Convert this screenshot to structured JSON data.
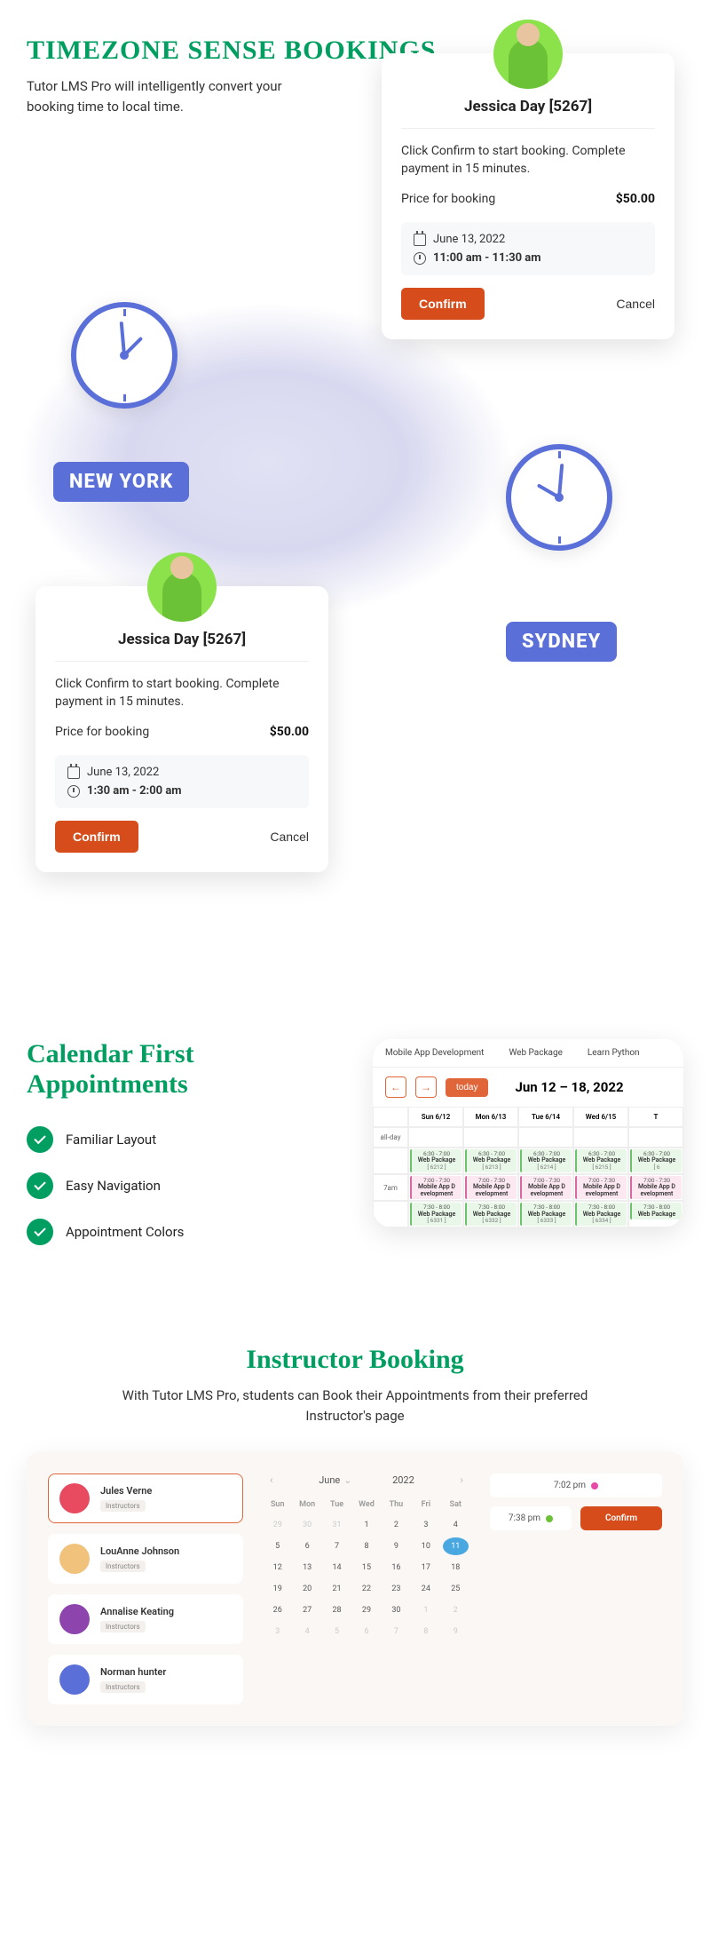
{
  "section1": {
    "heading": "Timezone Sense Bookings",
    "sub": "Tutor LMS Pro will intelligently convert your booking time to local time.",
    "city_ny": "NEW YORK",
    "city_sydney": "SYDNEY"
  },
  "card1": {
    "name": "Jessica Day [5267]",
    "desc": "Click Confirm to start booking. Complete payment in 15 minutes.",
    "price_label": "Price for booking",
    "price": "$50.00",
    "date": "June 13, 2022",
    "time": "11:00 am  -  11:30 am",
    "confirm": "Confirm",
    "cancel": "Cancel"
  },
  "card2": {
    "name": "Jessica Day [5267]",
    "desc": "Click Confirm to start booking. Complete payment in 15 minutes.",
    "price_label": "Price for booking",
    "price": "$50.00",
    "date": "June 13, 2022",
    "time": "1:30 am  -  2:00 am",
    "confirm": "Confirm",
    "cancel": "Cancel"
  },
  "section2": {
    "heading": "Calendar First Appointments",
    "check1": "Familiar Layout",
    "check2": "Easy Navigation",
    "check3": "Appointment Colors"
  },
  "calprev": {
    "tab1": "Mobile App Development",
    "tab2": "Web Package",
    "tab3": "Learn Python",
    "today": "today",
    "title": "Jun 12 – 18, 2022",
    "allday": "all-day",
    "time7": "7am",
    "days": [
      "Sun 6/12",
      "Mon 6/13",
      "Tue 6/14",
      "Wed 6/15",
      "T"
    ],
    "row1": {
      "time": "6:30 - 7:00",
      "name": "Web Package",
      "ids": [
        "[ 6212 ]",
        "[ 6213 ]",
        "[ 6214 ]",
        "[ 6215 ]",
        "[ 6"
      ]
    },
    "row2": {
      "time": "7:00 - 7:30",
      "name": "Mobile App Development",
      "ids": [
        "",
        "",
        "",
        "",
        ""
      ]
    },
    "row3": {
      "time": "7:30 - 8:00",
      "name": "Web Package",
      "ids": [
        "[ 6331 ]",
        "[ 6332 ]",
        "[ 6333 ]",
        "[ 6334 ]",
        ""
      ]
    }
  },
  "section3": {
    "heading": "Instructor Booking",
    "sub": "With Tutor LMS Pro, students can Book their Appointments from their preferred Instructor's page"
  },
  "instructors": [
    {
      "name": "Jules Verne",
      "role": "Instructors"
    },
    {
      "name": "LouAnne Johnson",
      "role": "Instructors"
    },
    {
      "name": "Annalise Keating",
      "role": "Instructors"
    },
    {
      "name": "Norman hunter",
      "role": "Instructors"
    }
  ],
  "minical": {
    "month": "June",
    "year": "2022",
    "dow": [
      "Sun",
      "Mon",
      "Tue",
      "Wed",
      "Thu",
      "Fri",
      "Sat"
    ],
    "days": [
      {
        "d": "29",
        "m": true
      },
      {
        "d": "30",
        "m": true
      },
      {
        "d": "31",
        "m": true
      },
      {
        "d": "1"
      },
      {
        "d": "2"
      },
      {
        "d": "3"
      },
      {
        "d": "4"
      },
      {
        "d": "5"
      },
      {
        "d": "6"
      },
      {
        "d": "7"
      },
      {
        "d": "8"
      },
      {
        "d": "9"
      },
      {
        "d": "10"
      },
      {
        "d": "11",
        "sel": true
      },
      {
        "d": "12"
      },
      {
        "d": "13"
      },
      {
        "d": "14"
      },
      {
        "d": "15"
      },
      {
        "d": "16"
      },
      {
        "d": "17"
      },
      {
        "d": "18"
      },
      {
        "d": "19"
      },
      {
        "d": "20"
      },
      {
        "d": "21"
      },
      {
        "d": "22"
      },
      {
        "d": "23"
      },
      {
        "d": "24"
      },
      {
        "d": "25"
      },
      {
        "d": "26"
      },
      {
        "d": "27"
      },
      {
        "d": "28"
      },
      {
        "d": "29"
      },
      {
        "d": "30"
      },
      {
        "d": "1",
        "m": true
      },
      {
        "d": "2",
        "m": true
      },
      {
        "d": "3",
        "m": true
      },
      {
        "d": "4",
        "m": true
      },
      {
        "d": "5",
        "m": true
      },
      {
        "d": "6",
        "m": true
      },
      {
        "d": "7",
        "m": true
      },
      {
        "d": "8",
        "m": true
      },
      {
        "d": "9",
        "m": true
      }
    ]
  },
  "slots": {
    "slot1": "7:02 pm",
    "slot2": "7:38 pm",
    "confirm": "Confirm"
  }
}
